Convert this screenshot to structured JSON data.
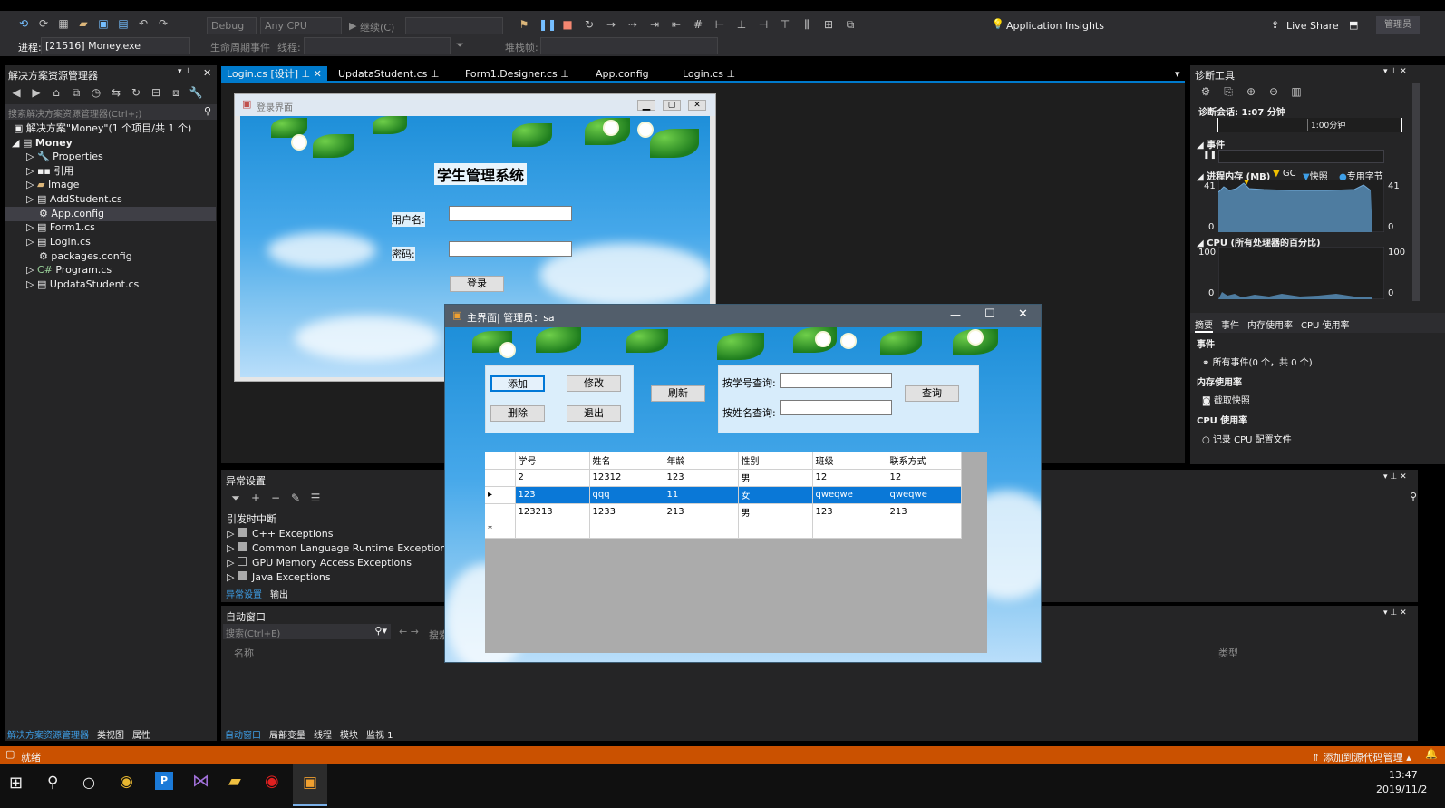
{
  "toolbar": {
    "config": "Debug",
    "platform": "Any CPU",
    "continue": "继续(C)",
    "insights": "Application Insights",
    "liveshare": "Live Share",
    "admin": "管理员",
    "process_label": "进程:",
    "process_value": "[21516] Money.exe",
    "lifecycle": "生命周期事件",
    "thread": "线程:",
    "stackframe": "堆栈帧:"
  },
  "solution": {
    "title": "解决方案资源管理器",
    "search_placeholder": "搜索解决方案资源管理器(Ctrl+;)",
    "root": "解决方案\"Money\"(1 个项目/共 1 个)",
    "project": "Money",
    "items": [
      "Properties",
      "引用",
      "Image",
      "AddStudent.cs",
      "App.config",
      "Form1.cs",
      "Login.cs",
      "packages.config",
      "Program.cs",
      "UpdataStudent.cs"
    ],
    "bottom_tabs": [
      "解决方案资源管理器",
      "类视图",
      "属性"
    ]
  },
  "tabs": [
    "Login.cs [设计]",
    "UpdataStudent.cs",
    "Form1.Designer.cs",
    "App.config",
    "Login.cs"
  ],
  "login_form": {
    "title": "登录界面",
    "heading": "学生管理系统",
    "user_label": "用户名:",
    "pass_label": "密码:",
    "login_button": "登录"
  },
  "main_form": {
    "title": "主界面| 管理员：sa",
    "add": "添加",
    "edit": "修改",
    "delete": "删除",
    "exit": "退出",
    "refresh": "刷新",
    "by_id": "按学号查询:",
    "by_name": "按姓名查询:",
    "query": "查询",
    "columns": [
      "学号",
      "姓名",
      "年龄",
      "性别",
      "班级",
      "联系方式"
    ],
    "rows": [
      [
        "2",
        "12312",
        "123",
        "男",
        "12",
        "12"
      ],
      [
        "123",
        "qqq",
        "11",
        "女",
        "qweqwe",
        "qweqwe"
      ],
      [
        "123213",
        "1233",
        "213",
        "男",
        "123",
        "213"
      ]
    ],
    "new_row_marker": "*"
  },
  "exceptions": {
    "title": "异常设置",
    "break_when": "引发时中断",
    "items": [
      "C++ Exceptions",
      "Common Language Runtime Exceptions",
      "GPU Memory Access Exceptions",
      "Java Exceptions"
    ],
    "tabs": [
      "异常设置",
      "输出"
    ]
  },
  "autos": {
    "title": "自动窗口",
    "search_placeholder": "搜索(Ctrl+E)",
    "search_depth": "搜索",
    "col_name": "名称",
    "col_type": "类型",
    "tabs": [
      "自动窗口",
      "局部变量",
      "线程",
      "模块",
      "监视 1"
    ]
  },
  "diag": {
    "title": "诊断工具",
    "session": "诊断会话: 1:07 分钟",
    "timeline_label": "1:00分钟",
    "events": "事件",
    "memory": "进程内存 (MB)",
    "gc": "GC",
    "snapshot": "快照",
    "private_bytes": "专用字节",
    "mem_max": "41",
    "mem_min": "0",
    "cpu": "CPU (所有处理器的百分比)",
    "cpu_max": "100",
    "cpu_min": "0",
    "tabs": [
      "摘要",
      "事件",
      "内存使用率",
      "CPU 使用率"
    ],
    "sec_events": "事件",
    "all_events": "所有事件(0 个，共 0 个)",
    "sec_mem": "内存使用率",
    "take_snapshot": "截取快照",
    "sec_cpu": "CPU 使用率",
    "record_cpu": "记录 CPU 配置文件"
  },
  "status": {
    "ready": "就绪",
    "source_control": "添加到源代码管理"
  },
  "taskbar": {
    "time": "13:47",
    "date": "2019/11/2"
  },
  "colors": {
    "accent": "#007acc",
    "status_bar": "#ca5100",
    "selection_row": "#0a78d7"
  }
}
